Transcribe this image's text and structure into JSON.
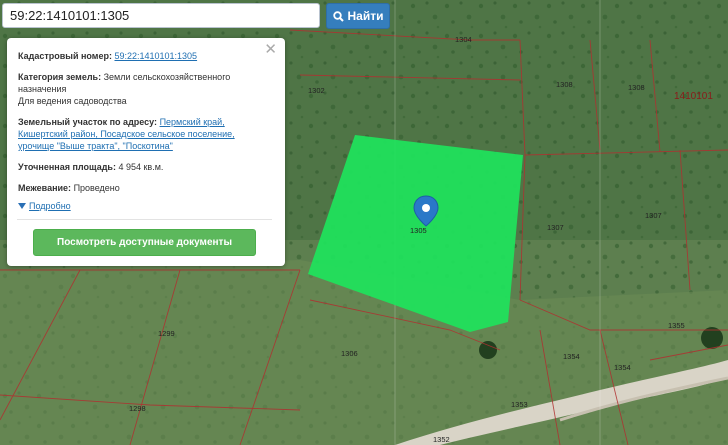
{
  "search": {
    "value": "59:22:1410101:1305",
    "button_label": "Найти"
  },
  "map": {
    "quarter_label": "1410101",
    "parcels": {
      "p1304": "1304",
      "p1302": "1302",
      "p1308": "1308",
      "p1308b": "1308",
      "p1307a": "1307",
      "p1307b": "1307",
      "p1305": "1305",
      "p1299": "1299",
      "p1306": "1306",
      "p1298": "1298",
      "p1355": "1355",
      "p1354a": "1354",
      "p1354b": "1354",
      "p1353": "1353",
      "p1352": "1352"
    }
  },
  "popup": {
    "cadastral_label": "Кадастровый номер:",
    "cadastral_value": "59:22:1410101:1305",
    "category_label": "Категория земель:",
    "category_value": "Земли сельскохозяйственного назначения",
    "usage_value": "Для ведения садоводства",
    "address_label": "Земельный участок по адресу:",
    "address_value": "Пермский край, Кишертский район, Посадское сельское поселение, урочище \"Выше тракта\", \"Поскотина\"",
    "area_label": "Уточненная площадь:",
    "area_value": "4 954 кв.м.",
    "survey_label": "Межевание:",
    "survey_value": "Проведено",
    "details_label": "Подробно",
    "docs_button_label": "Посмотреть доступные документы"
  },
  "colors": {
    "parcel_highlight": "#1ee45c",
    "search_button": "#357ebd",
    "docs_button": "#5cb85c",
    "boundary": "#b03030",
    "link": "#1f6fb2"
  }
}
